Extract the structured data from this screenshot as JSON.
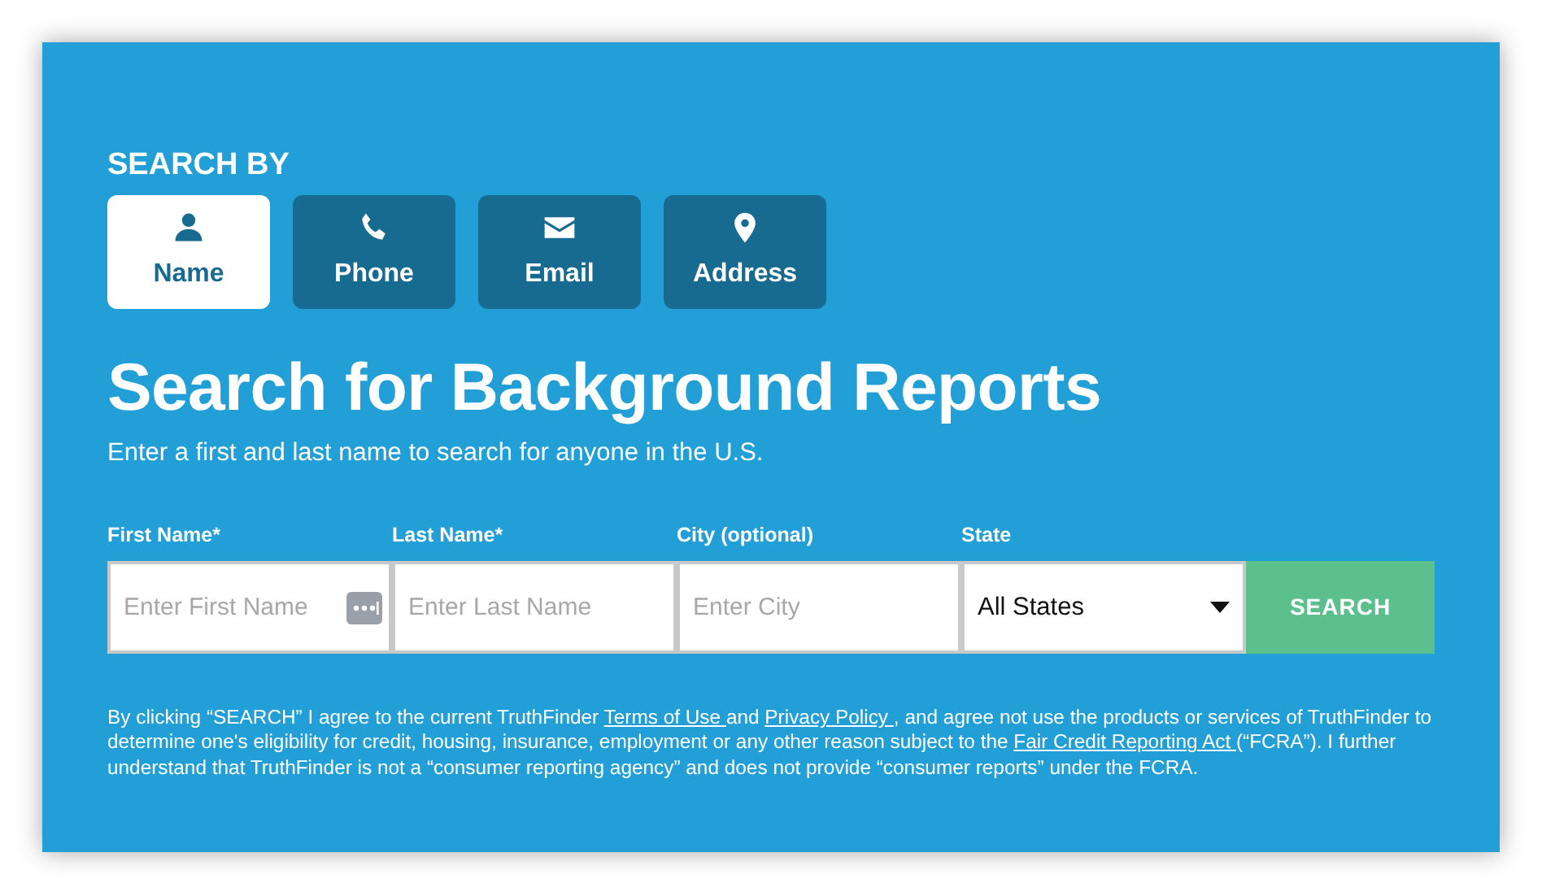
{
  "search_by": {
    "label": "SEARCH BY",
    "tabs": [
      {
        "label": "Name",
        "selected": true
      },
      {
        "label": "Phone",
        "selected": false
      },
      {
        "label": "Email",
        "selected": false
      },
      {
        "label": "Address",
        "selected": false
      }
    ]
  },
  "heading": "Search for Background Reports",
  "subtitle": "Enter a first and last name to search for anyone in the U.S.",
  "form": {
    "fields": [
      {
        "kind": "text",
        "label": "First Name*",
        "placeholder": "Enter First Name",
        "autofill": true
      },
      {
        "kind": "text",
        "label": "Last Name*",
        "placeholder": "Enter Last Name"
      },
      {
        "kind": "text",
        "label": "City (optional)",
        "placeholder": "Enter City"
      },
      {
        "kind": "select",
        "label": "State",
        "value": "All States"
      }
    ],
    "button": "SEARCH"
  },
  "disclaimer": [
    {
      "kind": "text",
      "text": "By clicking “SEARCH” I agree to the current TruthFinder "
    },
    {
      "kind": "link",
      "text": "Terms of Use "
    },
    {
      "kind": "text",
      "text": "and "
    },
    {
      "kind": "link",
      "text": "Privacy Policy "
    },
    {
      "kind": "text",
      "text": ", and agree not use the products or services of TruthFinder to determine one's eligibility for credit, housing, insurance, employment or any other reason subject to the "
    },
    {
      "kind": "link",
      "text": "Fair Credit Reporting Act "
    },
    {
      "kind": "text",
      "text": "(“FCRA”). I further understand that TruthFinder is not a “consumer reporting agency” and does not provide “consumer reports” under the FCRA."
    }
  ]
}
